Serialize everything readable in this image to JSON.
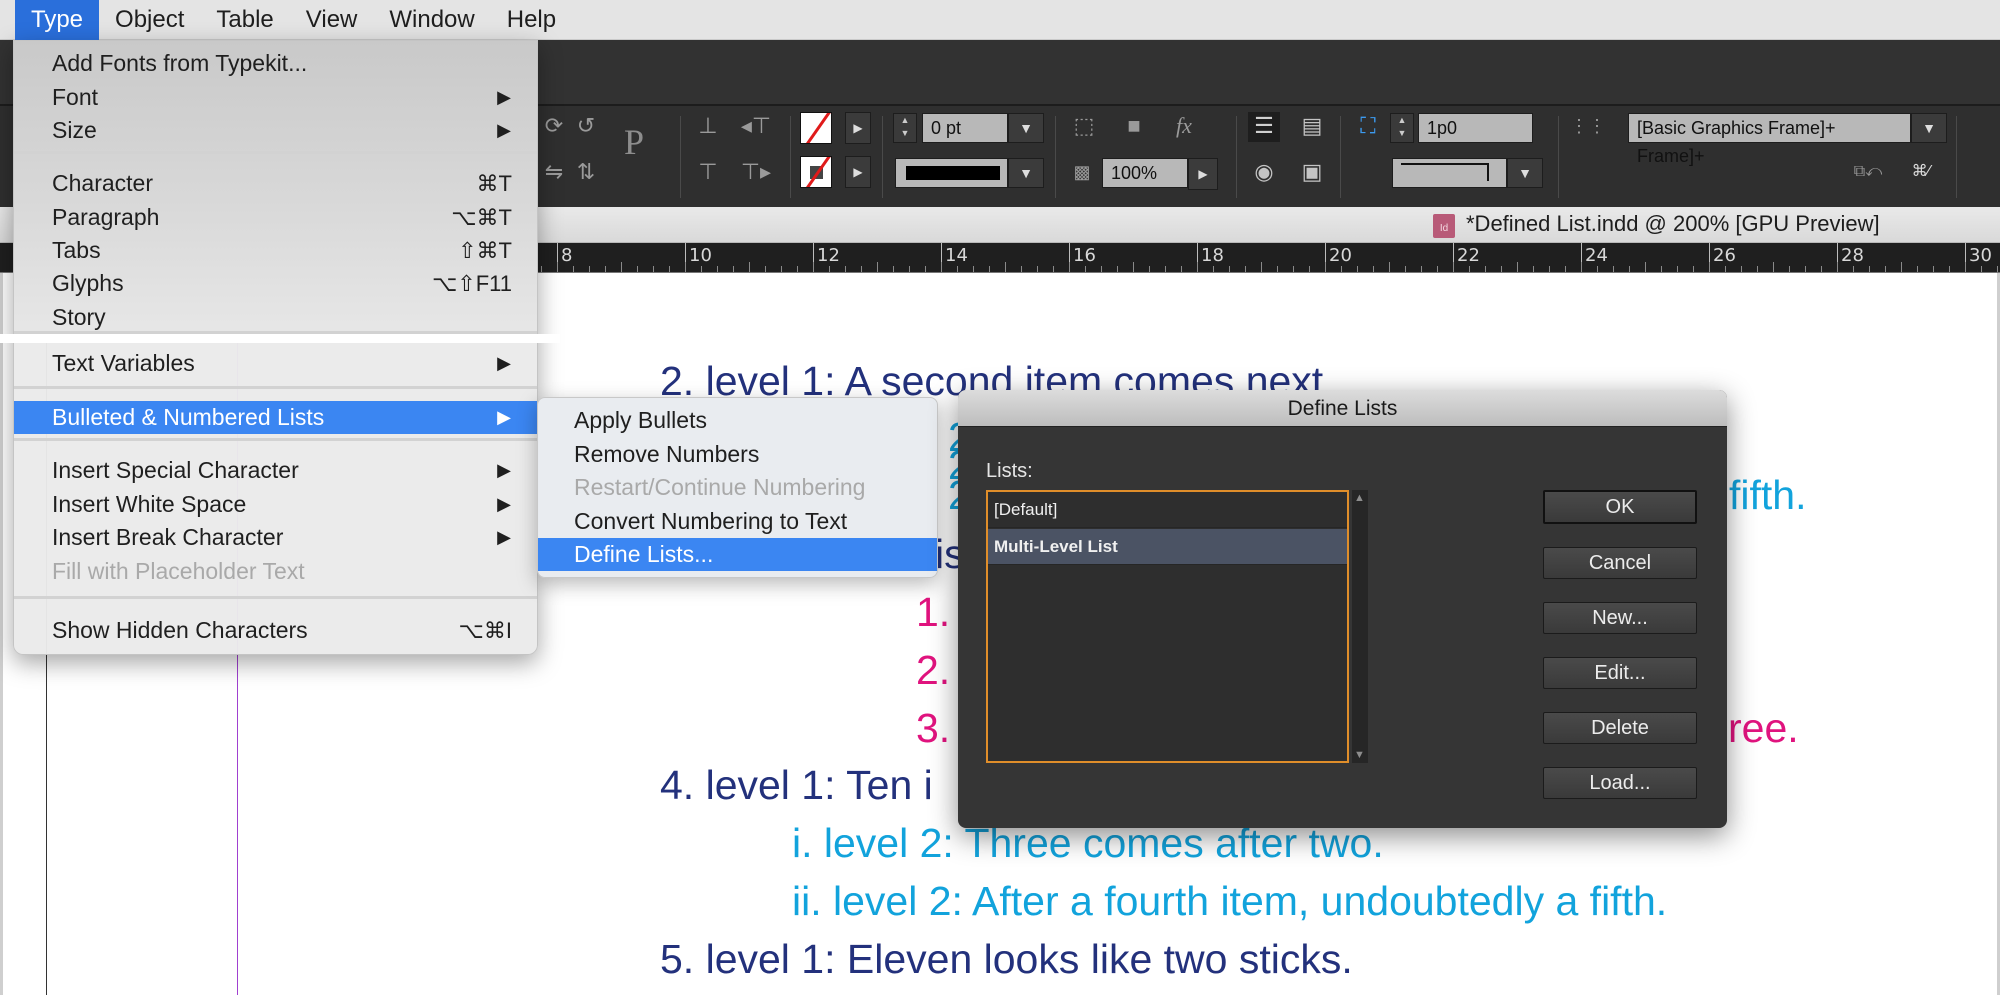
{
  "menubar": {
    "items": [
      "Type",
      "Object",
      "Table",
      "View",
      "Window",
      "Help"
    ],
    "active": "Type"
  },
  "control_panel": {
    "stroke_weight": "0 pt",
    "opacity": "100%",
    "offset": "1p0",
    "object_style": "[Basic Graphics Frame]+",
    "reference_point_glyph": "P"
  },
  "document": {
    "tab_title": "*Defined List.indd @ 200% [GPU Preview]",
    "doc_icon": "Id"
  },
  "ruler": {
    "labels": [
      "8",
      "10",
      "12",
      "14",
      "16",
      "18",
      "20",
      "22",
      "24",
      "26",
      "28",
      "30"
    ]
  },
  "type_menu": {
    "items": [
      {
        "label": "Add Fonts from Typekit...",
        "shortcut": "",
        "submenu": false,
        "disabled": false
      },
      {
        "label": "Font",
        "shortcut": "",
        "submenu": true,
        "disabled": false
      },
      {
        "label": "Size",
        "shortcut": "",
        "submenu": true,
        "disabled": false
      },
      {
        "label": "Character",
        "shortcut": "⌘T",
        "submenu": false,
        "disabled": false
      },
      {
        "label": "Paragraph",
        "shortcut": "⌥⌘T",
        "submenu": false,
        "disabled": false
      },
      {
        "label": "Tabs",
        "shortcut": "⇧⌘T",
        "submenu": false,
        "disabled": false
      },
      {
        "label": "Glyphs",
        "shortcut": "⌥⇧F11",
        "submenu": false,
        "disabled": false
      },
      {
        "label": "Story",
        "shortcut": "",
        "submenu": false,
        "disabled": false
      },
      {
        "label": "Text Variables",
        "shortcut": "",
        "submenu": true,
        "disabled": false
      },
      {
        "label": "Bulleted & Numbered Lists",
        "shortcut": "",
        "submenu": true,
        "disabled": false,
        "highlighted": true
      },
      {
        "label": "Insert Special Character",
        "shortcut": "",
        "submenu": true,
        "disabled": false
      },
      {
        "label": "Insert White Space",
        "shortcut": "",
        "submenu": true,
        "disabled": false
      },
      {
        "label": "Insert Break Character",
        "shortcut": "",
        "submenu": true,
        "disabled": false
      },
      {
        "label": "Fill with Placeholder Text",
        "shortcut": "",
        "submenu": false,
        "disabled": true
      },
      {
        "label": "Show Hidden Characters",
        "shortcut": "⌥⌘I",
        "submenu": false,
        "disabled": false
      }
    ]
  },
  "lists_submenu": {
    "items": [
      {
        "label": "Apply Bullets",
        "disabled": false
      },
      {
        "label": "Remove Numbers",
        "disabled": false
      },
      {
        "label": "Restart/Continue Numbering",
        "disabled": true
      },
      {
        "label": "Convert Numbering to Text",
        "disabled": false
      },
      {
        "label": "Define Lists...",
        "disabled": false,
        "highlighted": true
      }
    ]
  },
  "define_lists_dialog": {
    "title": "Define Lists",
    "lists_label": "Lists:",
    "lists": [
      {
        "name": "[Default]",
        "selected": false
      },
      {
        "name": "Multi-Level List",
        "selected": true
      }
    ],
    "buttons": [
      "OK",
      "Cancel",
      "New...",
      "Edit...",
      "Delete",
      "Load..."
    ]
  },
  "doc_text": {
    "line_2_level1": "2. level 1: A second item comes next",
    "partial_level2_a": "2",
    "partial_level2_b": "2",
    "partial_level2_c": "2",
    "fifth_fragment": "fifth.",
    "is_fragment": "is",
    "lvl3_1": "1.",
    "lvl3_2": "2.",
    "lvl3_3": "3.",
    "ree_fragment": "ree.",
    "line_4_level1": "4. level 1: Ten i",
    "line_i_level2": "i.  level 2: Three comes after two.",
    "line_ii_level2": "ii. level 2: After a fourth item, undoubtedly a fifth.",
    "line_5_level1": "5. level 1: Eleven looks like two sticks."
  },
  "colors": {
    "level1": "#23317c",
    "level2": "#12a3dc",
    "level3": "#e0137e",
    "menu_highlight": "#3b86f2",
    "dialog_focus": "#e08e2a"
  }
}
